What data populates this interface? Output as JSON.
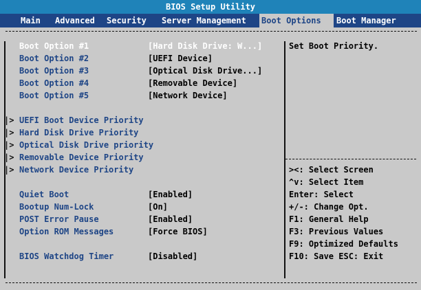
{
  "title": "BIOS Setup Utility",
  "menu": {
    "main": "Main",
    "advanced": "Advanced",
    "security": "Security",
    "server": "Server Management",
    "boot_options": "Boot Options",
    "boot_manager": "Boot Manager"
  },
  "boot_options": [
    {
      "label": "Boot Option #1",
      "value": "[Hard Disk Drive: W...]"
    },
    {
      "label": "Boot Option #2",
      "value": "[UEFI Device]"
    },
    {
      "label": "Boot Option #3",
      "value": "[Optical Disk Drive...]"
    },
    {
      "label": "Boot Option #4",
      "value": "[Removable Device]"
    },
    {
      "label": "Boot Option #5",
      "value": "[Network Device]"
    }
  ],
  "submenus": [
    {
      "prefix": "|>",
      "label": "UEFI Boot Device Priority"
    },
    {
      "prefix": "|>",
      "label": "Hard Disk Drive Priority"
    },
    {
      "prefix": "|>",
      "label": "Optical Disk Drive priority"
    },
    {
      "prefix": "|>",
      "label": "Removable Device Priority"
    },
    {
      "prefix": "|>",
      "label": "Network Device Priority"
    }
  ],
  "settings": [
    {
      "label": "Quiet Boot",
      "value": "[Enabled]"
    },
    {
      "label": "Bootup Num-Lock",
      "value": "[On]"
    },
    {
      "label": "POST Error Pause",
      "value": "[Enabled]"
    },
    {
      "label": "Option ROM Messages",
      "value": "[Force BIOS]"
    }
  ],
  "watchdog": {
    "label": "BIOS Watchdog Timer",
    "value": "[Disabled]"
  },
  "help": {
    "text": "Set Boot Priority."
  },
  "keys": [
    "><: Select Screen",
    "^v: Select Item",
    "Enter: Select",
    "+/-: Change Opt.",
    "F1: General Help",
    "F3: Previous Values",
    "F9: Optimized Defaults",
    "F10: Save  ESC: Exit"
  ]
}
